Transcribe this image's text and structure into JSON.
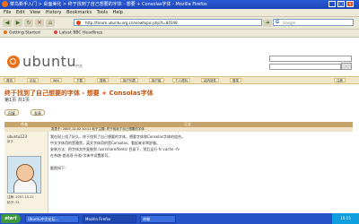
{
  "window": {
    "title": "菜鸟新手入门 > 桌面美化 > 终于找到了自己想要的字体 - 想要 + Consolas字体 - Mozilla Firefox",
    "controls": [
      "_",
      "□",
      "×"
    ]
  },
  "menu": [
    "File",
    "Edit",
    "View",
    "History",
    "Bookmarks",
    "Tools",
    "Help"
  ],
  "nav": {
    "url": "http://forum.ubuntu.org.cn/viewtopic.php?t=80348",
    "search_placeholder": "Google"
  },
  "bookmarks": [
    "Getting Started",
    "Latest BBC Headlines"
  ],
  "site": {
    "logo_text": "ubuntu",
    "logo_sub": "中文",
    "tabs": [
      "首页",
      "论坛",
      "Wiki",
      "下载",
      "搜索",
      "用户列表",
      "用户组",
      "个人资料",
      "站内信件",
      "登录",
      "注册"
    ]
  },
  "topic": {
    "title": "终于找到了自己想要的字体 - 想要 + Consolas字体",
    "page_info": "第1页 共1页",
    "reply_label": "回复",
    "new_label": "发表"
  },
  "table": {
    "col_author": "作者",
    "col_message": "正文",
    "subhead": "发表于: 2007-12-02 10:11    帖子主题: 终于找到了自己想要的字体"
  },
  "post": {
    "author": "ubuntu123",
    "rank": "新手",
    "stats": [
      "注册: 2007-10-11",
      "帖子: 31"
    ],
    "lines": [
      "我在网上找了好久，终于找到了自己想要的字体，想要字体和Consolas字体的组合。",
      "中文字体用的是雅黑，英文字体用的是Consolas，看起来非常舒服。",
      "安装方法：把字体文件复制到 /usr/share/fonts/ 目录下，然后运行 fc-cache -fv",
      "在系统-首选项-外观-字体中设置即可。",
      "",
      "截图如下："
    ]
  },
  "taskbar": {
    "start": "start",
    "tasks": [
      "Ubuntu中文论坛...",
      "Mozilla Firefox",
      "终端"
    ],
    "clock": "10:15"
  }
}
